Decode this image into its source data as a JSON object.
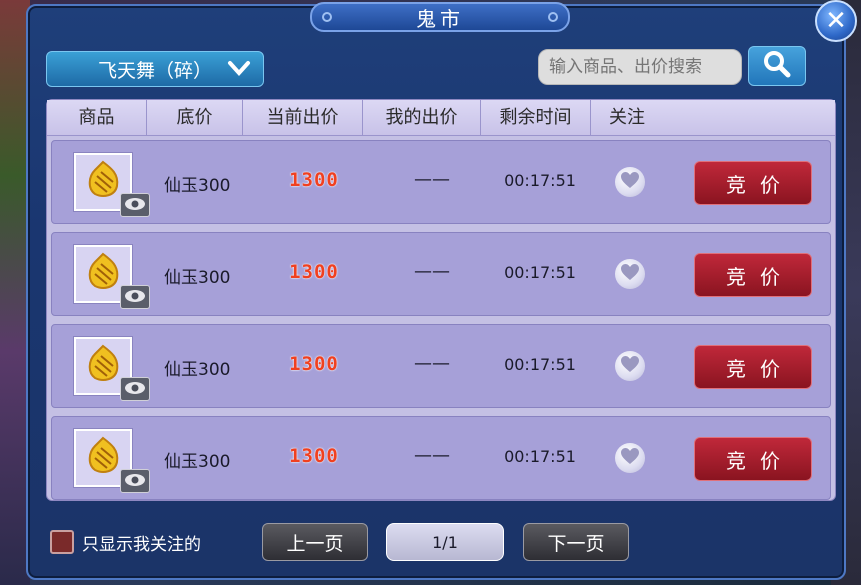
{
  "title": "鬼市",
  "dropdown": {
    "selected": "飞天舞（碎）"
  },
  "search": {
    "placeholder": "输入商品、出价搜索"
  },
  "columns": [
    "商品",
    "底价",
    "当前出价",
    "我的出价",
    "剩余时间",
    "关注"
  ],
  "rows": [
    {
      "base_price": "仙玉300",
      "current_bid": "1300",
      "my_bid": "——",
      "time_left": "00:17:51",
      "bid_label": "竞价"
    },
    {
      "base_price": "仙玉300",
      "current_bid": "1300",
      "my_bid": "——",
      "time_left": "00:17:51",
      "bid_label": "竞价"
    },
    {
      "base_price": "仙玉300",
      "current_bid": "1300",
      "my_bid": "——",
      "time_left": "00:17:51",
      "bid_label": "竞价"
    },
    {
      "base_price": "仙玉300",
      "current_bid": "1300",
      "my_bid": "——",
      "time_left": "00:17:51",
      "bid_label": "竞价"
    }
  ],
  "filter": {
    "label": "只显示我关注的"
  },
  "pagination": {
    "prev": "上一页",
    "indicator": "1/1",
    "next": "下一页"
  },
  "icons": {
    "close": "close-icon",
    "dropdown": "chevron-down-icon",
    "search": "search-icon",
    "item": "jade-item-icon",
    "view": "eye-icon",
    "favorite": "heart-icon"
  },
  "colors": {
    "panel": "#1b3468",
    "list_bg": "#c4c0e4",
    "row_bg": "#a6a0d8",
    "bid_button": "#a41c2c",
    "current_bid_text": "#f04020"
  }
}
